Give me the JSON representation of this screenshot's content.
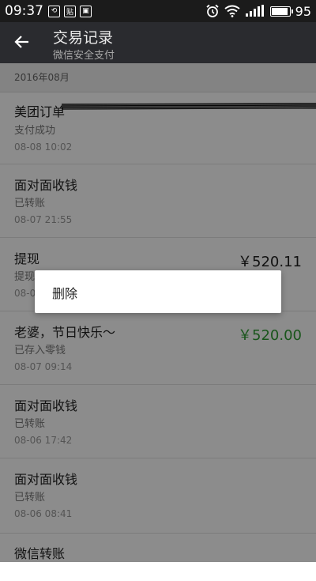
{
  "status_bar": {
    "time": "09:37",
    "notif_icons": [
      "wechat-icon",
      "tieba-icon",
      "gallery-icon"
    ],
    "notif_glyphs": [
      "⟲",
      "贴",
      "▣"
    ],
    "right_icons": [
      "alarm-icon",
      "wifi-icon",
      "signal-icon",
      "battery-icon"
    ],
    "battery_level": "95",
    "battery_fraction": 0.95
  },
  "app_bar": {
    "title": "交易记录",
    "subtitle": "微信安全支付"
  },
  "month_header": "2016年08月",
  "transactions": [
    {
      "title": "美团订单",
      "status": "支付成功",
      "time": "08-08 10:02",
      "amount": ""
    },
    {
      "title": "面对面收钱",
      "status": "已转账",
      "time": "08-07 21:55",
      "amount": ""
    },
    {
      "title": "提现",
      "status": "提现",
      "time": "08-07",
      "amount": "￥520.11"
    },
    {
      "title": "老婆，节日快乐～",
      "status": "已存入零钱",
      "time": "08-07 09:14",
      "amount": "￥520.00",
      "amount_color": "#2e9c32"
    },
    {
      "title": "面对面收钱",
      "status": "已转账",
      "time": "08-06 17:42",
      "amount": ""
    },
    {
      "title": "面对面收钱",
      "status": "已转账",
      "time": "08-06 08:41",
      "amount": ""
    },
    {
      "title": "微信转账",
      "status": "",
      "time": "",
      "amount": ""
    }
  ],
  "dialog": {
    "delete_label": "删除"
  },
  "colors": {
    "status_bar": "#1b1b1b",
    "app_bar": "#2a2b2f",
    "income_green": "#2e9c32",
    "overlay": "rgba(0,0,0,0.45)"
  }
}
